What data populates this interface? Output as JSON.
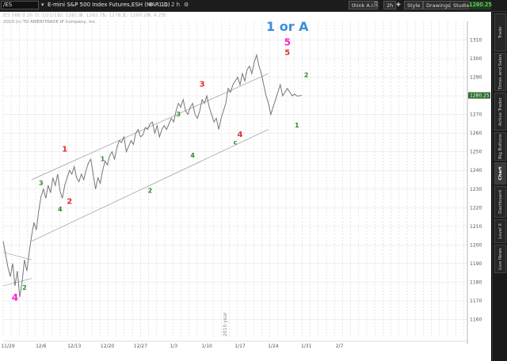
{
  "toolbar": {
    "symbol": "/ES",
    "description": "E-mini S&P 500 Index Futures,ESH (MAR 11)",
    "settings": [
      "B",
      "1 D",
      "2 h"
    ],
    "think_label": "think A.I.",
    "timeframe": "2h",
    "style_label": "Style",
    "drawings_label": "Drawings",
    "studies_label": "Studies",
    "price": "1280.25"
  },
  "infobar": {
    "symbol": "/ES 588 d 2h",
    "date": "D: 1/21/11",
    "open": "O: 1281.5",
    "high": "H: 1282.75",
    "low": "L: 1278.5",
    "close": "C: 1280.25",
    "range": "R: 4.25",
    "extra": "Y:",
    "copyright": "2010 (c) TD AMERITRADE IP Company, Inc."
  },
  "side_tabs": [
    {
      "label": "Trade",
      "active": false
    },
    {
      "label": "Times and Sales",
      "active": false
    },
    {
      "label": "Active Trader",
      "active": false
    },
    {
      "label": "Big Buttons",
      "active": false
    },
    {
      "label": "Chart",
      "active": true
    },
    {
      "label": "Dashboard",
      "active": false
    },
    {
      "label": "Level II",
      "active": false
    },
    {
      "label": "Live News",
      "active": false
    }
  ],
  "chart_data": {
    "type": "line",
    "x_labels": [
      "11/29",
      "12/6",
      "12/13",
      "12/20",
      "12/27",
      "1/3",
      "1/10",
      "1/17",
      "1/24",
      "1/31",
      "2/7"
    ],
    "price_ticks": [
      1310,
      1300,
      1290,
      1280,
      1270,
      1260,
      1250,
      1240,
      1230,
      1220,
      1210,
      1200,
      1190,
      1180,
      1170,
      1160
    ],
    "year_label": "2010 year",
    "last_price": "1280.25",
    "x": [
      0,
      0.5,
      1,
      1.5,
      2,
      2.5,
      3,
      3.5,
      4,
      4.5,
      5,
      5.5,
      6,
      6.5,
      7,
      7.5,
      8,
      8.5,
      9,
      9.5,
      10,
      10.5,
      11,
      11.5,
      12,
      12.5,
      13,
      13.5,
      14,
      14.5,
      15,
      15.5,
      16,
      16.5,
      17,
      17.5,
      18,
      18.5,
      19,
      19.5,
      20,
      20.5,
      21,
      21.5,
      22,
      22.5,
      23,
      23.5,
      24,
      24.5,
      25,
      25.5,
      26,
      26.5,
      27,
      27.5,
      28,
      28.5,
      29,
      29.5,
      30,
      30.5,
      31,
      31.5,
      32,
      32.5,
      33,
      33.5,
      34,
      34.5,
      35,
      35.5,
      36,
      36.5,
      37,
      37.5,
      38,
      38.5,
      39,
      39.5,
      40,
      40.5,
      41,
      41.5,
      42,
      42.5,
      43,
      43.5,
      44,
      44.5,
      45,
      45.5,
      46,
      46.5,
      47,
      47.5,
      48,
      48.5,
      49,
      49.5,
      50,
      50.5,
      51,
      51.5,
      52,
      52.5,
      53,
      53.5,
      54,
      54.5,
      55,
      55.5,
      56,
      56.5,
      57,
      57.5,
      58,
      58.5,
      59,
      59.5,
      60,
      60.5,
      61,
      61.5,
      62,
      62.5,
      63
    ],
    "y": [
      1202,
      1195,
      1188,
      1183,
      1190,
      1178,
      1186,
      1172,
      1180,
      1192,
      1186,
      1196,
      1205,
      1212,
      1208,
      1218,
      1226,
      1230,
      1225,
      1232,
      1228,
      1236,
      1232,
      1238,
      1229,
      1225,
      1232,
      1236,
      1240,
      1238,
      1242,
      1236,
      1234,
      1238,
      1235,
      1240,
      1244,
      1246,
      1238,
      1230,
      1236,
      1233,
      1240,
      1245,
      1243,
      1248,
      1250,
      1246,
      1252,
      1256,
      1255,
      1258,
      1250,
      1253,
      1256,
      1254,
      1260,
      1262,
      1258,
      1259,
      1263,
      1262,
      1265,
      1266,
      1260,
      1264,
      1258,
      1262,
      1264,
      1262,
      1265,
      1268,
      1266,
      1272,
      1276,
      1274,
      1278,
      1272,
      1270,
      1274,
      1276,
      1270,
      1268,
      1272,
      1278,
      1276,
      1280,
      1274,
      1270,
      1266,
      1268,
      1262,
      1268,
      1272,
      1276,
      1284,
      1282,
      1286,
      1288,
      1290,
      1286,
      1292,
      1288,
      1294,
      1296,
      1292,
      1298,
      1302,
      1296,
      1292,
      1286,
      1280,
      1276,
      1270,
      1274,
      1278,
      1282,
      1286,
      1280,
      1282,
      1284,
      1282,
      1280,
      1281,
      1280,
      1280,
      1280.25
    ],
    "x_range": [
      0,
      98
    ],
    "ylim": [
      1150,
      1320
    ]
  },
  "annotations": [
    {
      "text": "1 or A",
      "color": "#3b8fd6",
      "day": 60,
      "price": 1315,
      "size": 16
    },
    {
      "text": "5",
      "color": "#ff22cc",
      "day": 60,
      "price": 1307,
      "size": 12
    },
    {
      "text": "5",
      "color": "#e23030",
      "day": 60,
      "price": 1302,
      "size": 10
    },
    {
      "text": "3",
      "color": "#e23030",
      "day": 42,
      "price": 1285,
      "size": 10
    },
    {
      "text": "1",
      "color": "#e23030",
      "day": 13,
      "price": 1250,
      "size": 10
    },
    {
      "text": "2",
      "color": "#e23030",
      "day": 14,
      "price": 1222,
      "size": 10
    },
    {
      "text": "4",
      "color": "#e23030",
      "day": 50,
      "price": 1258,
      "size": 10
    },
    {
      "text": "4",
      "color": "#ff22cc",
      "day": 2.5,
      "price": 1170,
      "size": 12
    },
    {
      "text": "1",
      "color": "#2a8a2a",
      "day": 62,
      "price": 1263,
      "size": 8
    },
    {
      "text": "2",
      "color": "#2a8a2a",
      "day": 64,
      "price": 1290,
      "size": 8
    },
    {
      "text": "3",
      "color": "#2a8a2a",
      "day": 37,
      "price": 1269,
      "size": 8
    },
    {
      "text": "4",
      "color": "#2a8a2a",
      "day": 40,
      "price": 1247,
      "size": 8
    },
    {
      "text": "1",
      "color": "#2a8a2a",
      "day": 21,
      "price": 1245,
      "size": 8
    },
    {
      "text": "2",
      "color": "#2a8a2a",
      "day": 31,
      "price": 1228,
      "size": 8
    },
    {
      "text": "3",
      "color": "#2a8a2a",
      "day": 8,
      "price": 1232,
      "size": 8
    },
    {
      "text": "4",
      "color": "#2a8a2a",
      "day": 12,
      "price": 1218,
      "size": 8
    },
    {
      "text": "2",
      "color": "#2a8a2a",
      "day": 4.5,
      "price": 1176,
      "size": 8
    },
    {
      "text": "c",
      "color": "#2a8a2a",
      "day": 49,
      "price": 1254,
      "size": 8
    }
  ]
}
